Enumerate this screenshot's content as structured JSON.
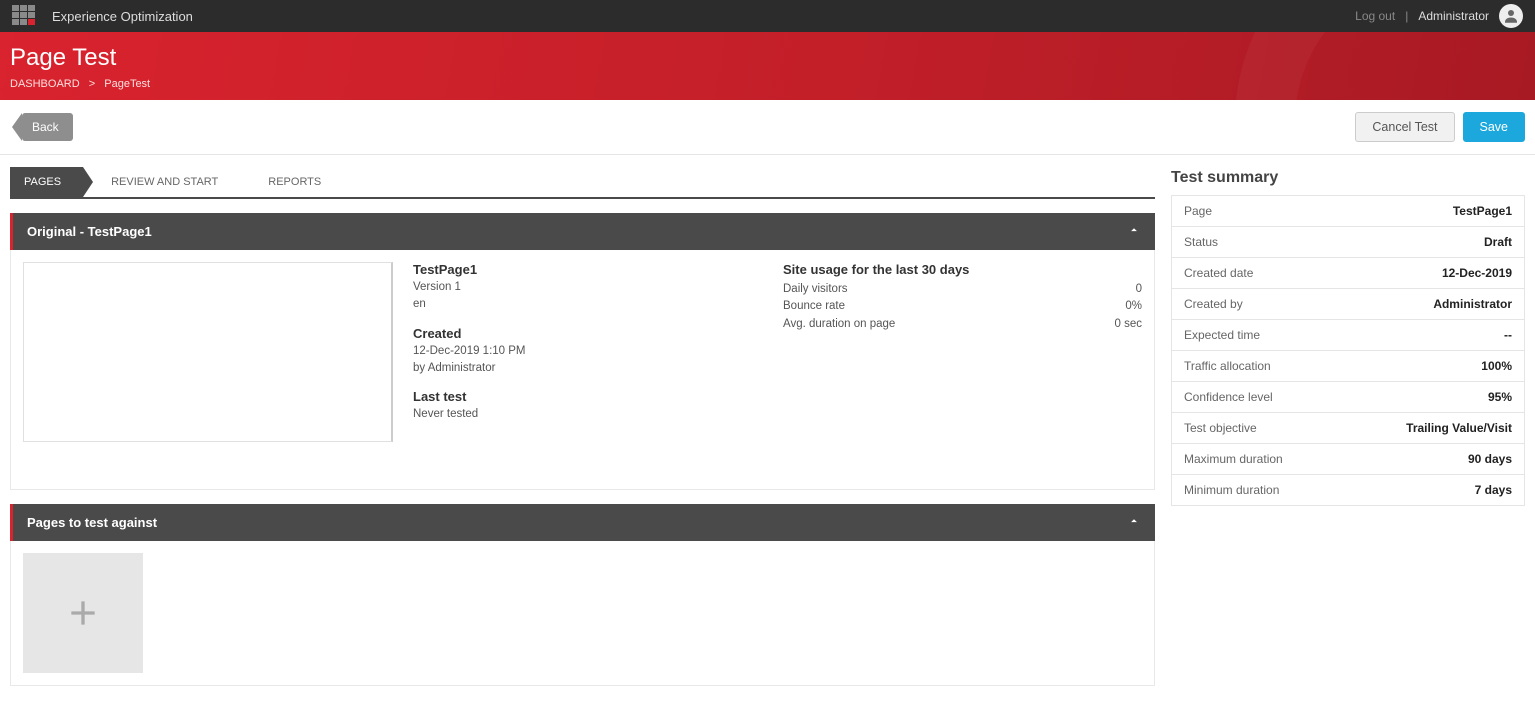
{
  "topbar": {
    "app_title": "Experience Optimization",
    "logout_label": "Log out",
    "user_name": "Administrator"
  },
  "banner": {
    "page_title": "Page Test",
    "breadcrumb_root": "DASHBOARD",
    "breadcrumb_current": "PageTest"
  },
  "actions": {
    "back_label": "Back",
    "cancel_label": "Cancel Test",
    "save_label": "Save"
  },
  "tabs": {
    "items": [
      {
        "label": "PAGES",
        "active": true
      },
      {
        "label": "REVIEW AND START",
        "active": false
      },
      {
        "label": "REPORTS",
        "active": false
      }
    ]
  },
  "original_panel": {
    "header": "Original - TestPage1",
    "page_name": "TestPage1",
    "version_line": "Version 1",
    "language": "en",
    "created_label": "Created",
    "created_date": "12-Dec-2019 1:10 PM",
    "created_by": "by Administrator",
    "last_test_label": "Last test",
    "last_test_value": "Never tested",
    "usage_header": "Site usage for the last 30 days",
    "usage": [
      {
        "label": "Daily visitors",
        "value": "0"
      },
      {
        "label": "Bounce rate",
        "value": "0%"
      },
      {
        "label": "Avg. duration on page",
        "value": "0 sec"
      }
    ]
  },
  "test_against_panel": {
    "header": "Pages to test against"
  },
  "summary": {
    "title": "Test summary",
    "rows": [
      {
        "label": "Page",
        "value": "TestPage1"
      },
      {
        "label": "Status",
        "value": "Draft"
      },
      {
        "label": "Created date",
        "value": "12-Dec-2019"
      },
      {
        "label": "Created by",
        "value": "Administrator"
      },
      {
        "label": "Expected time",
        "value": "--"
      },
      {
        "label": "Traffic allocation",
        "value": "100%"
      },
      {
        "label": "Confidence level",
        "value": "95%"
      },
      {
        "label": "Test objective",
        "value": "Trailing Value/Visit"
      },
      {
        "label": "Maximum duration",
        "value": "90 days"
      },
      {
        "label": "Minimum duration",
        "value": "7 days"
      }
    ]
  }
}
